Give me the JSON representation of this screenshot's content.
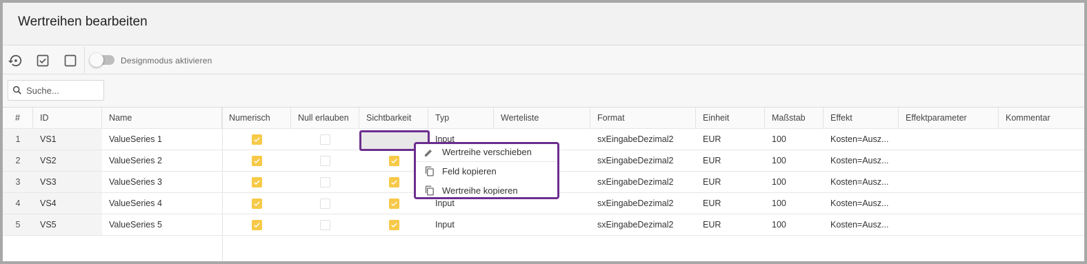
{
  "window": {
    "title": "Wertreihen bearbeiten"
  },
  "toolbar": {
    "reset_icon": "history-icon",
    "check_all_icon": "checkbox-checked-icon",
    "uncheck_all_icon": "checkbox-empty-icon",
    "design_mode_label": "Designmodus aktivieren",
    "design_mode_on": false
  },
  "search": {
    "placeholder": "Suche...",
    "value": ""
  },
  "columns": {
    "num": "#",
    "id": "ID",
    "name": "Name",
    "numerisch": "Numerisch",
    "null_erlauben": "Null erlauben",
    "sichtbarkeit": "Sichtbarkeit",
    "typ": "Typ",
    "werteliste": "Werteliste",
    "format": "Format",
    "einheit": "Einheit",
    "massstab": "Maßstab",
    "effekt": "Effekt",
    "effektparameter": "Effektparameter",
    "kommentar": "Kommentar"
  },
  "rows": [
    {
      "num": "1",
      "id": "VS1",
      "name": "ValueSeries 1",
      "numerisch": true,
      "null_erlauben": false,
      "sichtbarkeit": true,
      "typ": "Input",
      "werteliste": "",
      "format": "sxEingabeDezimal2",
      "einheit": "EUR",
      "massstab": "100",
      "effekt": "Kosten=Ausz...",
      "effektparameter": "",
      "kommentar": ""
    },
    {
      "num": "2",
      "id": "VS2",
      "name": "ValueSeries 2",
      "numerisch": true,
      "null_erlauben": false,
      "sichtbarkeit": true,
      "typ": "",
      "werteliste": "",
      "format": "sxEingabeDezimal2",
      "einheit": "EUR",
      "massstab": "100",
      "effekt": "Kosten=Ausz...",
      "effektparameter": "",
      "kommentar": ""
    },
    {
      "num": "3",
      "id": "VS3",
      "name": "ValueSeries 3",
      "numerisch": true,
      "null_erlauben": false,
      "sichtbarkeit": true,
      "typ": "",
      "werteliste": "",
      "format": "sxEingabeDezimal2",
      "einheit": "EUR",
      "massstab": "100",
      "effekt": "Kosten=Ausz...",
      "effektparameter": "",
      "kommentar": ""
    },
    {
      "num": "4",
      "id": "VS4",
      "name": "ValueSeries 4",
      "numerisch": true,
      "null_erlauben": false,
      "sichtbarkeit": true,
      "typ": "Input",
      "werteliste": "",
      "format": "sxEingabeDezimal2",
      "einheit": "EUR",
      "massstab": "100",
      "effekt": "Kosten=Ausz...",
      "effektparameter": "",
      "kommentar": ""
    },
    {
      "num": "5",
      "id": "VS5",
      "name": "ValueSeries 5",
      "numerisch": true,
      "null_erlauben": false,
      "sichtbarkeit": true,
      "typ": "Input",
      "werteliste": "",
      "format": "sxEingabeDezimal2",
      "einheit": "EUR",
      "massstab": "100",
      "effekt": "Kosten=Ausz...",
      "effektparameter": "",
      "kommentar": ""
    }
  ],
  "context_menu": {
    "items": [
      {
        "label": "Wertreihe verschieben",
        "icon": "edit-icon"
      },
      {
        "label": "Feld kopieren",
        "icon": "copy-icon"
      },
      {
        "label": "Wertreihe kopieren",
        "icon": "copy-icon"
      }
    ]
  },
  "colors": {
    "checkbox_on": "#f7c948",
    "highlight_border": "#6c2e8f"
  }
}
